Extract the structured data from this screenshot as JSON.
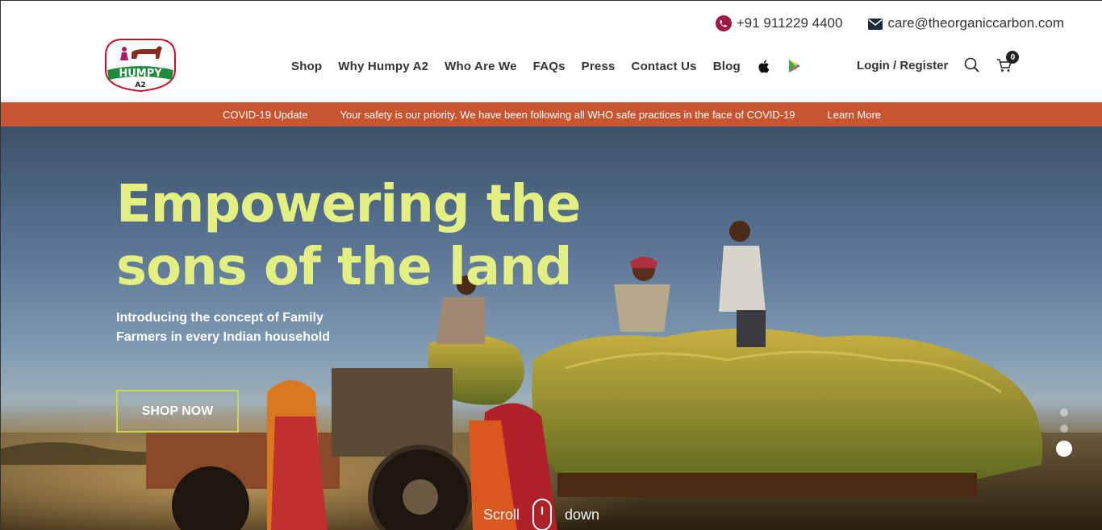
{
  "header": {
    "logo": {
      "brand": "HUMPY",
      "sub": "A2"
    },
    "contact": {
      "phone": "+91 911229 4400",
      "email": "care@theorganiccarbon.com"
    },
    "nav": [
      {
        "label": "Shop"
      },
      {
        "label": "Why Humpy A2"
      },
      {
        "label": "Who Are We"
      },
      {
        "label": "FAQs"
      },
      {
        "label": "Press"
      },
      {
        "label": "Contact Us"
      },
      {
        "label": "Blog"
      }
    ],
    "app_icons": [
      "apple-icon",
      "google-play-icon"
    ],
    "login_label": "Login / Register",
    "cart_count": "0"
  },
  "covid_bar": {
    "title": "COVID-19 Update",
    "message": "Your safety is our priority. We have been following all WHO safe practices in the face of COVID-19",
    "link": "Learn More",
    "color": "#c85430"
  },
  "hero": {
    "title_line1": "Empowering the",
    "title_line2": "sons of the land",
    "subtitle": "Introducing the concept of Family Farmers in every Indian household",
    "cta": "SHOP NOW",
    "scroll_left": "Scroll",
    "scroll_right": "down",
    "slides": 3,
    "active_slide": 3,
    "title_color": "#e3ef80"
  }
}
